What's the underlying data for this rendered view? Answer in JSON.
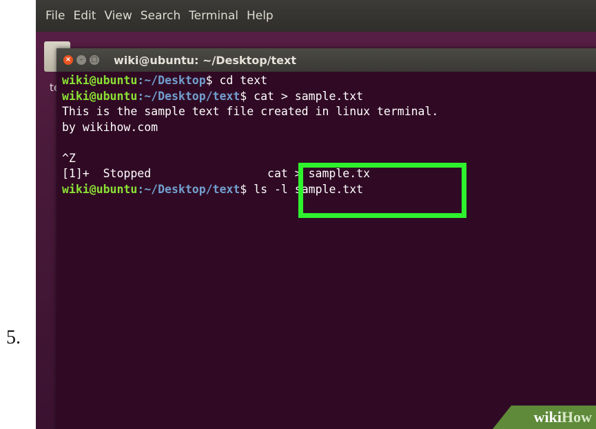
{
  "step_number": "5.",
  "menubar": {
    "items": [
      "File",
      "Edit",
      "View",
      "Search",
      "Terminal",
      "Help"
    ]
  },
  "desktop": {
    "partial_label": "te"
  },
  "terminal": {
    "title": "wiki@ubuntu: ~/Desktop/text",
    "lines": [
      {
        "user": "wiki@ubuntu",
        "sep": ":",
        "path": "~/Desktop",
        "prompt": "$ ",
        "cmd": "cd text"
      },
      {
        "user": "wiki@ubuntu",
        "sep": ":",
        "path": "~/Desktop/text",
        "prompt": "$ ",
        "cmd": "cat > sample.txt"
      },
      {
        "text": "This is the sample text file created in linux terminal."
      },
      {
        "text": "by wikihow.com"
      },
      {
        "text": ""
      },
      {
        "text": "^Z"
      },
      {
        "text": "[1]+  Stopped                 cat > sample.tx"
      },
      {
        "user": "wiki@ubuntu",
        "sep": ":",
        "path": "~/Desktop/text",
        "prompt": "$ ",
        "cmd": "ls -l sample.txt"
      }
    ]
  },
  "watermark": {
    "part1": "wiki",
    "part2": "How"
  },
  "colors": {
    "highlight": "#2ef22e",
    "terminal_bg": "#300a24",
    "user": "#8ae234",
    "path": "#729fcf"
  }
}
